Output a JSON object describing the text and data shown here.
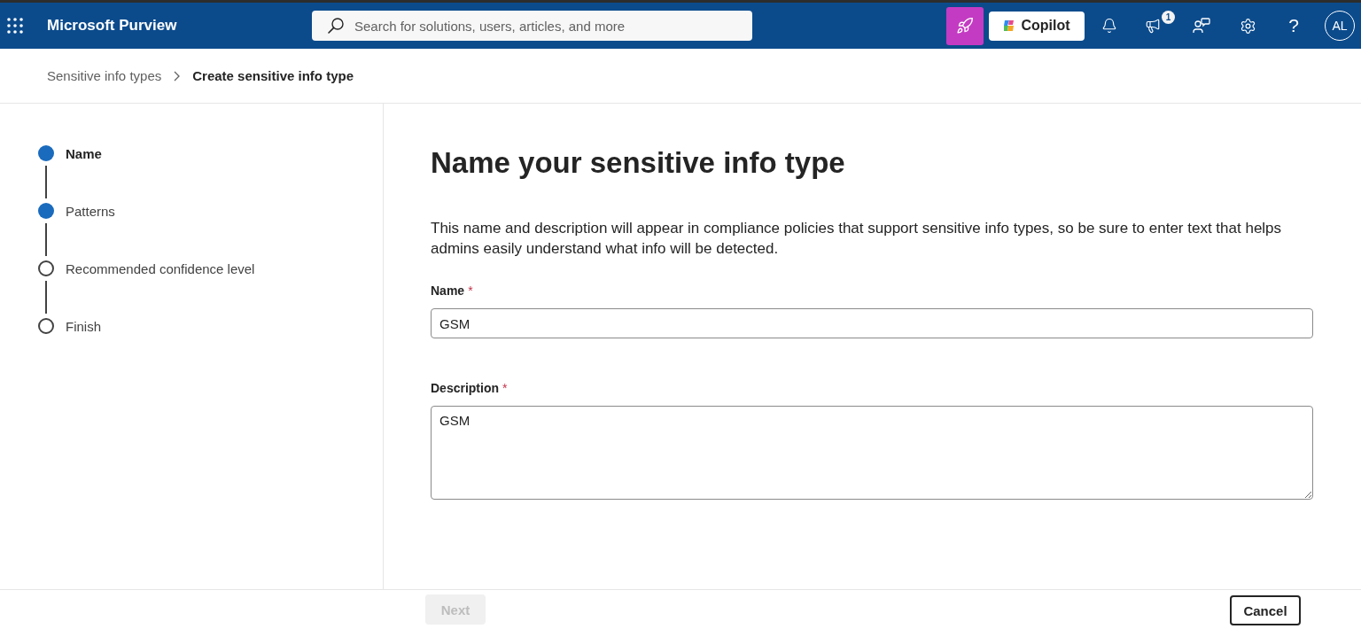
{
  "header": {
    "app_title": "Microsoft Purview",
    "search": {
      "placeholder": "Search for solutions, users, articles, and more"
    },
    "copilot_button": {
      "label": "Copilot"
    },
    "announcements_badge": "1",
    "help_glyph": "?",
    "avatar_initials": "AL"
  },
  "breadcrumb": [
    {
      "label": "Sensitive info types",
      "current": false
    },
    {
      "label": "Create sensitive info type",
      "current": true
    }
  ],
  "steps": [
    {
      "label": "Name",
      "selected": true,
      "filled": true
    },
    {
      "label": "Patterns",
      "selected": false,
      "filled": true
    },
    {
      "label": "Recommended confidence level",
      "selected": false,
      "filled": false
    },
    {
      "label": "Finish",
      "selected": false,
      "filled": false
    }
  ],
  "page": {
    "title": "Name your sensitive info type",
    "intro": "This name and description will appear in compliance policies that support sensitive info types, so be sure to enter text that helps admins easily understand what info will be detected."
  },
  "fields": [
    {
      "kind": "input",
      "label": "Name",
      "required_mark": "*",
      "value": "GSM"
    },
    {
      "kind": "textarea",
      "label": "Description",
      "required_mark": "*",
      "value": "GSM"
    }
  ],
  "footer_buttons": [
    {
      "kind": "primary",
      "label": "Next",
      "disabled": true
    },
    {
      "kind": "secondary",
      "label": "Cancel",
      "disabled": false
    }
  ]
}
